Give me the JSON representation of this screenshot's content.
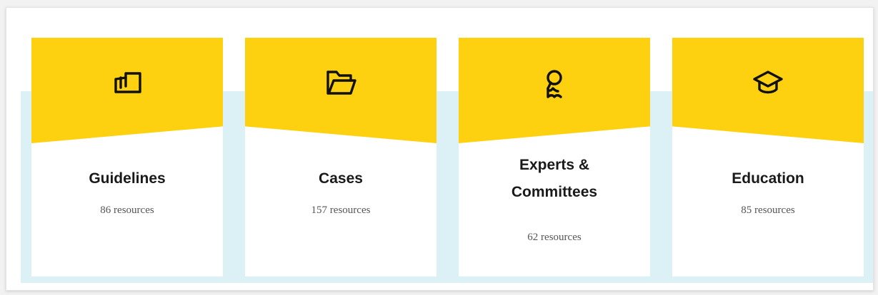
{
  "colors": {
    "accent_yellow": "#fdd10f",
    "band_blue": "#dcf1f5",
    "card_bg": "#ffffff",
    "title_text": "#1a1a1a",
    "count_text": "#555555"
  },
  "cards": [
    {
      "icon": "open-book-icon",
      "title": "Guidelines",
      "count": "86 resources"
    },
    {
      "icon": "folder-icon",
      "title": "Cases",
      "count": "157 resources"
    },
    {
      "icon": "person-badge-icon",
      "title_line1": "Experts &",
      "title_line2": "Committees",
      "count": "62 resources"
    },
    {
      "icon": "graduation-cap-icon",
      "title": "Education",
      "count": "85 resources"
    }
  ]
}
